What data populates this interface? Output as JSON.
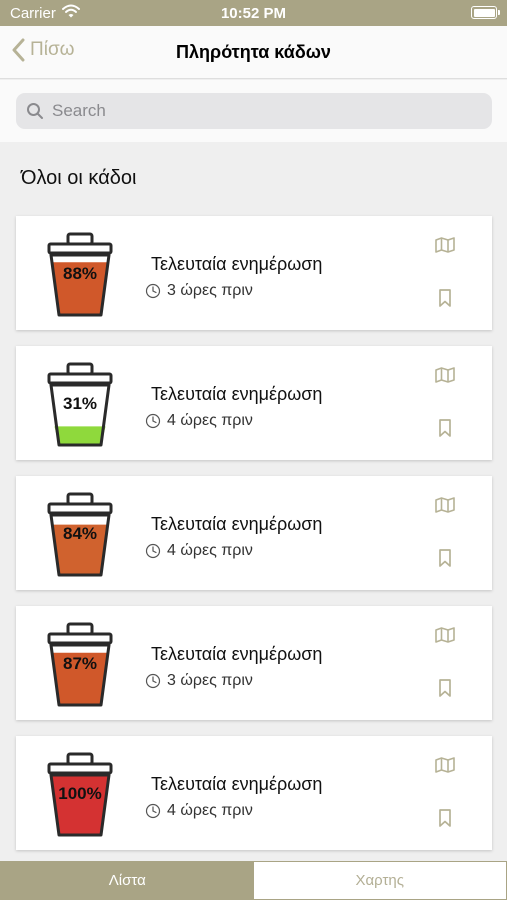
{
  "status_bar": {
    "carrier": "Carrier",
    "time": "10:52 PM"
  },
  "nav": {
    "back_label": "Πίσω",
    "title": "Πληρότητα κάδων"
  },
  "search": {
    "placeholder": "Search"
  },
  "section_title": "Όλοι οι κάδοι",
  "bins": [
    {
      "fill": 0.88,
      "percent_label": "88%",
      "color": "#d0582a",
      "updated_label": "Τελευταία ενημέρωση",
      "time_ago": "3 ώρες πριν"
    },
    {
      "fill": 0.31,
      "percent_label": "31%",
      "color": "#8fd93c",
      "updated_label": "Τελευταία ενημέρωση",
      "time_ago": "4 ώρες πριν"
    },
    {
      "fill": 0.84,
      "percent_label": "84%",
      "color": "#d0622e",
      "updated_label": "Τελευταία ενημέρωση",
      "time_ago": "4 ώρες πριν"
    },
    {
      "fill": 0.87,
      "percent_label": "87%",
      "color": "#d0582a",
      "updated_label": "Τελευταία ενημέρωση",
      "time_ago": "3 ώρες πριν"
    },
    {
      "fill": 1.0,
      "percent_label": "100%",
      "color": "#d43232",
      "updated_label": "Τελευταία ενημέρωση",
      "time_ago": "4 ώρες πριν"
    }
  ],
  "tabs": [
    {
      "label": "Λίστα",
      "active": true
    },
    {
      "label": "Χαρτης",
      "active": false
    }
  ],
  "colors": {
    "accent": "#a9a485",
    "icon": "#b6b296"
  },
  "icons": {
    "back": "chevron-left-icon",
    "search": "search-icon",
    "clock": "clock-icon",
    "map": "map-icon",
    "bookmark": "bookmark-icon",
    "wifi": "wifi-icon",
    "battery": "battery-icon"
  }
}
